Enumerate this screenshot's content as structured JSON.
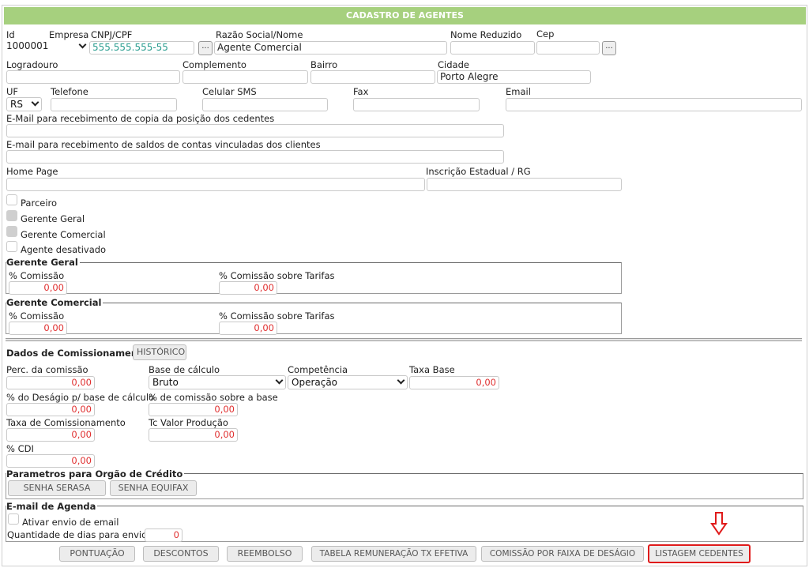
{
  "header": {
    "title": "CADASTRO DE AGENTES"
  },
  "row1": {
    "id_label": "Id",
    "id_value": "1000001",
    "empresa_label": "Empresa",
    "cnpj_label": "CNPJ/CPF",
    "cnpj_value": "555.555.555-55",
    "razao_label": "Razão Social/Nome",
    "razao_value": "Agente Comercial",
    "nome_reduzido_label": "Nome Reduzido",
    "cep_label": "Cep"
  },
  "row2": {
    "logradouro_label": "Logradouro",
    "complemento_label": "Complemento",
    "bairro_label": "Bairro",
    "cidade_label": "Cidade",
    "cidade_value": "Porto Alegre"
  },
  "row3": {
    "uf_label": "UF",
    "uf_value": "RS",
    "telefone_label": "Telefone",
    "celular_label": "Celular SMS",
    "fax_label": "Fax",
    "email_label": "Email"
  },
  "emails": {
    "copia_label": "E-Mail para recebimento de copia da posição dos cedentes",
    "saldos_label": "E-mail para recebimento de saldos de contas vinculadas dos clientes"
  },
  "row4": {
    "homepage_label": "Home Page",
    "ie_label": "Inscrição Estadual / RG"
  },
  "checks": {
    "parceiro": "Parceiro",
    "gerente_geral": "Gerente Geral",
    "gerente_comercial": "Gerente Comercial",
    "agente_desativado": "Agente desativado"
  },
  "gerente_geral": {
    "legend": "Gerente Geral",
    "comissao_label": "% Comissão",
    "comissao_value": "0,00",
    "tarifas_label": "% Comissão sobre Tarifas",
    "tarifas_value": "0,00"
  },
  "gerente_comercial": {
    "legend": "Gerente Comercial",
    "comissao_label": "% Comissão",
    "comissao_value": "0,00",
    "tarifas_label": "% Comissão sobre Tarifas",
    "tarifas_value": "0,00"
  },
  "comissionamento": {
    "title": "Dados de Comissionamento",
    "historico_button": "HISTÓRICO",
    "perc_label": "Perc. da comissão",
    "perc_value": "0,00",
    "base_label": "Base de cálculo",
    "base_value": "Bruto",
    "competencia_label": "Competência",
    "competencia_value": "Operação",
    "taxa_base_label": "Taxa Base",
    "taxa_base_value": "0,00",
    "desagio_label": "% do Deságio p/ base de cálculo",
    "desagio_value": "0,00",
    "comissao_base_label": "% de comissão sobre a base",
    "comissao_base_value": "0,00",
    "taxa_comissionamento_label": "Taxa de Comissionamento",
    "taxa_comissionamento_value": "0,00",
    "tc_valor_label": "Tc Valor Produção",
    "tc_valor_value": "0,00",
    "cdi_label": "% CDI",
    "cdi_value": "0,00"
  },
  "credito": {
    "legend": "Parametros para Orgão de Crédito",
    "serasa_button": "SENHA SERASA",
    "equifax_button": "SENHA EQUIFAX"
  },
  "agenda": {
    "legend": "E-mail de Agenda",
    "ativar_label": "Ativar envio de email",
    "dias_label": "Quantidade de dias para envio",
    "dias_value": "0"
  },
  "footer": {
    "pontuacao": "PONTUAÇÃO",
    "descontos": "DESCONTOS",
    "reembolso": "REEMBOLSO",
    "tabela": "TABELA REMUNERAÇÃO TX EFETIVA",
    "comissao_faixa": "COMISSÃO POR FAIXA DE DESÁGIO",
    "listagem": "LISTAGEM CEDENTES"
  },
  "colors": {
    "header": "#a6d07e",
    "highlight": "#e01b1b",
    "number": "#e03030",
    "cnpj_text": "#2a9d8f"
  }
}
